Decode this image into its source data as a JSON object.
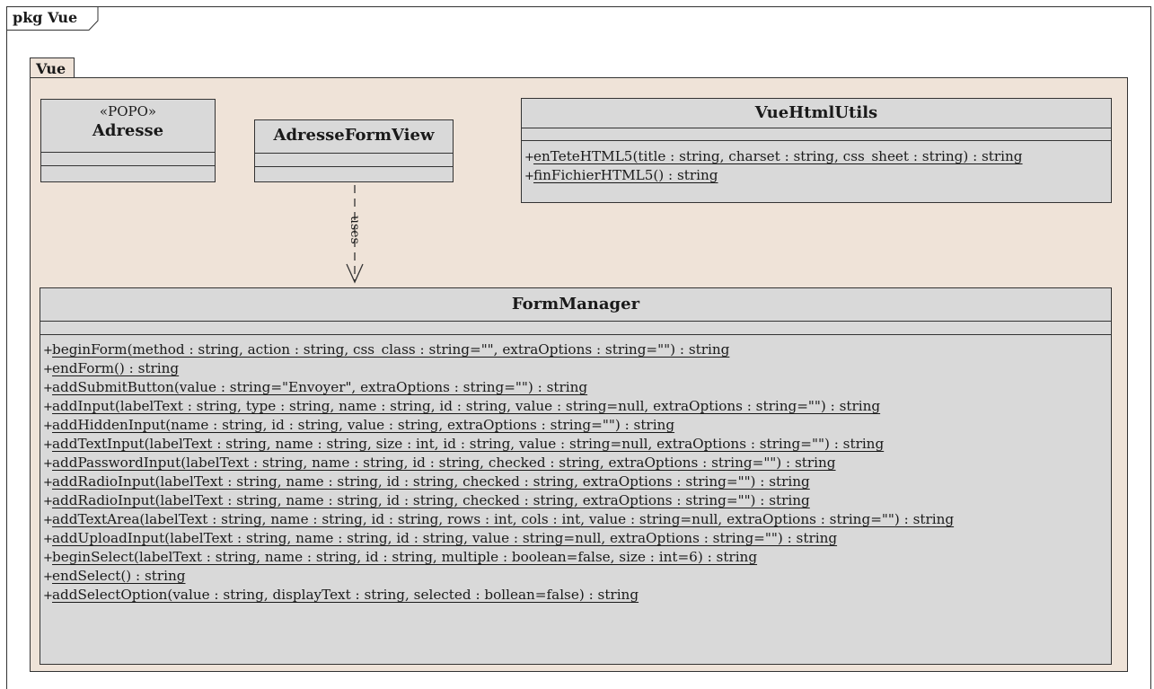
{
  "package": {
    "outer_label": "pkg Vue",
    "inner_label": "Vue"
  },
  "classes": {
    "adresse": {
      "stereotype": "«POPO»",
      "name": "Adresse"
    },
    "adresse_form_view": {
      "name": "AdresseFormView"
    },
    "vue_html_utils": {
      "name": "VueHtmlUtils",
      "operations": [
        {
          "visibility": "+",
          "signature": "enTeteHTML5(title : string, charset : string, css_sheet : string) : string"
        },
        {
          "visibility": "+",
          "signature": "finFichierHTML5() : string"
        }
      ]
    },
    "form_manager": {
      "name": "FormManager",
      "operations": [
        {
          "visibility": "+",
          "signature": "beginForm(method : string, action : string, css_class : string=\"\", extraOptions : string=\"\") : string"
        },
        {
          "visibility": "+",
          "signature": "endForm() : string"
        },
        {
          "visibility": "+",
          "signature": "addSubmitButton(value : string=\"Envoyer\", extraOptions : string=\"\") : string"
        },
        {
          "visibility": "+",
          "signature": "addInput(labelText : string, type : string, name : string, id : string, value : string=null, extraOptions : string=\"\") : string"
        },
        {
          "visibility": "+",
          "signature": "addHiddenInput(name : string, id : string, value : string, extraOptions : string=\"\") : string"
        },
        {
          "visibility": "+",
          "signature": "addTextInput(labelText : string, name : string, size : int, id : string, value : string=null, extraOptions : string=\"\") : string"
        },
        {
          "visibility": "+",
          "signature": "addPasswordInput(labelText : string, name : string, id : string, checked : string, extraOptions : string=\"\") : string"
        },
        {
          "visibility": "+",
          "signature": "addRadioInput(labelText : string, name : string, id : string, checked : string, extraOptions : string=\"\") : string"
        },
        {
          "visibility": "+",
          "signature": "addRadioInput(labelText : string, name : string, id : string, checked : string, extraOptions : string=\"\") : string"
        },
        {
          "visibility": "+",
          "signature": "addTextArea(labelText : string, name : string, id : string, rows : int, cols : int, value : string=null, extraOptions : string=\"\") : string"
        },
        {
          "visibility": "+",
          "signature": "addUploadInput(labelText : string, name : string, id : string, value : string=null, extraOptions : string=\"\") : string"
        },
        {
          "visibility": "+",
          "signature": "beginSelect(labelText : string, name : string, id : string, multiple : boolean=false, size : int=6) : string"
        },
        {
          "visibility": "+",
          "signature": "endSelect() : string"
        },
        {
          "visibility": "+",
          "signature": "addSelectOption(value : string, displayText : string, selected : bollean=false) : string"
        }
      ]
    }
  },
  "relations": [
    {
      "from": "AdresseFormView",
      "to": "FormManager",
      "kind": "dependency",
      "label": "uses"
    }
  ],
  "colors": {
    "package_fill": "#efe3d8",
    "class_fill": "#d9d9d9",
    "line": "#333333"
  }
}
